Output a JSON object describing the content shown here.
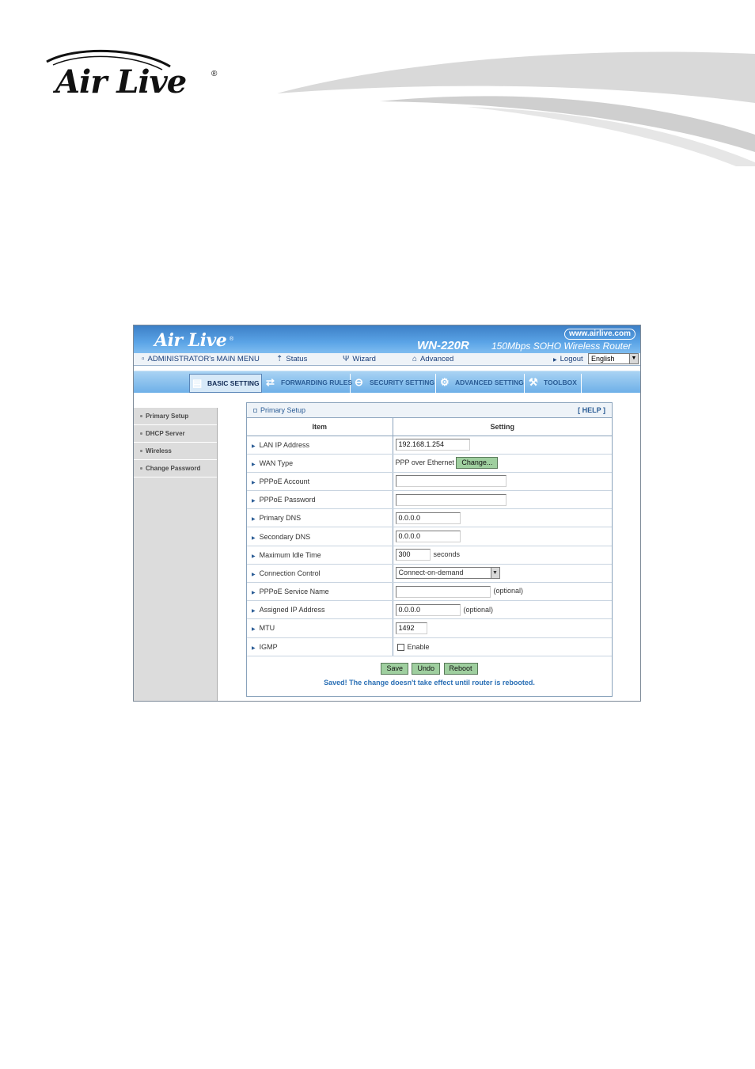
{
  "doc": {
    "logo_text": "Air Live",
    "logo_reg": "®"
  },
  "banner": {
    "brand": "Air Live",
    "brand_reg": "®",
    "url": "www.airlive.com",
    "model": "WN-220R",
    "model_desc": "150Mbps SOHO Wireless Router"
  },
  "menu": {
    "main": "ADMINISTRATOR's MAIN MENU",
    "status": "Status",
    "wizard": "Wizard",
    "advanced": "Advanced",
    "logout": "Logout",
    "language": "English"
  },
  "tabs": [
    {
      "label": "BASIC SETTING",
      "icon": "folder-icon"
    },
    {
      "label": "FORWARDING RULES",
      "icon": "arrows-icon"
    },
    {
      "label": "SECURITY SETTING",
      "icon": "lock-icon"
    },
    {
      "label": "ADVANCED SETTING",
      "icon": "gears-icon"
    },
    {
      "label": "TOOLBOX",
      "icon": "toolbox-icon"
    }
  ],
  "sidebar": [
    {
      "label": "Primary Setup"
    },
    {
      "label": "DHCP Server"
    },
    {
      "label": "Wireless"
    },
    {
      "label": "Change Password"
    }
  ],
  "panel": {
    "title": "Primary Setup",
    "help": "[ HELP ]",
    "col_item": "Item",
    "col_setting": "Setting",
    "rows": [
      {
        "label": "LAN IP Address",
        "value": "192.168.1.254"
      },
      {
        "label": "WAN Type",
        "value": "PPP over Ethernet",
        "button": "Change..."
      },
      {
        "label": "PPPoE Account",
        "value": ""
      },
      {
        "label": "PPPoE Password",
        "value": ""
      },
      {
        "label": "Primary DNS",
        "value": "0.0.0.0"
      },
      {
        "label": "Secondary DNS",
        "value": "0.0.0.0"
      },
      {
        "label": "Maximum Idle Time",
        "value": "300",
        "suffix": "seconds"
      },
      {
        "label": "Connection Control",
        "value": "Connect-on-demand"
      },
      {
        "label": "PPPoE Service Name",
        "value": "",
        "suffix": "(optional)"
      },
      {
        "label": "Assigned IP Address",
        "value": "0.0.0.0",
        "suffix": "(optional)"
      },
      {
        "label": "MTU",
        "value": "1492"
      },
      {
        "label": "IGMP",
        "suffix": "Enable"
      }
    ],
    "buttons": {
      "save": "Save",
      "undo": "Undo",
      "reboot": "Reboot"
    },
    "saved_message": "Saved! The change doesn't take effect until router is rebooted."
  }
}
